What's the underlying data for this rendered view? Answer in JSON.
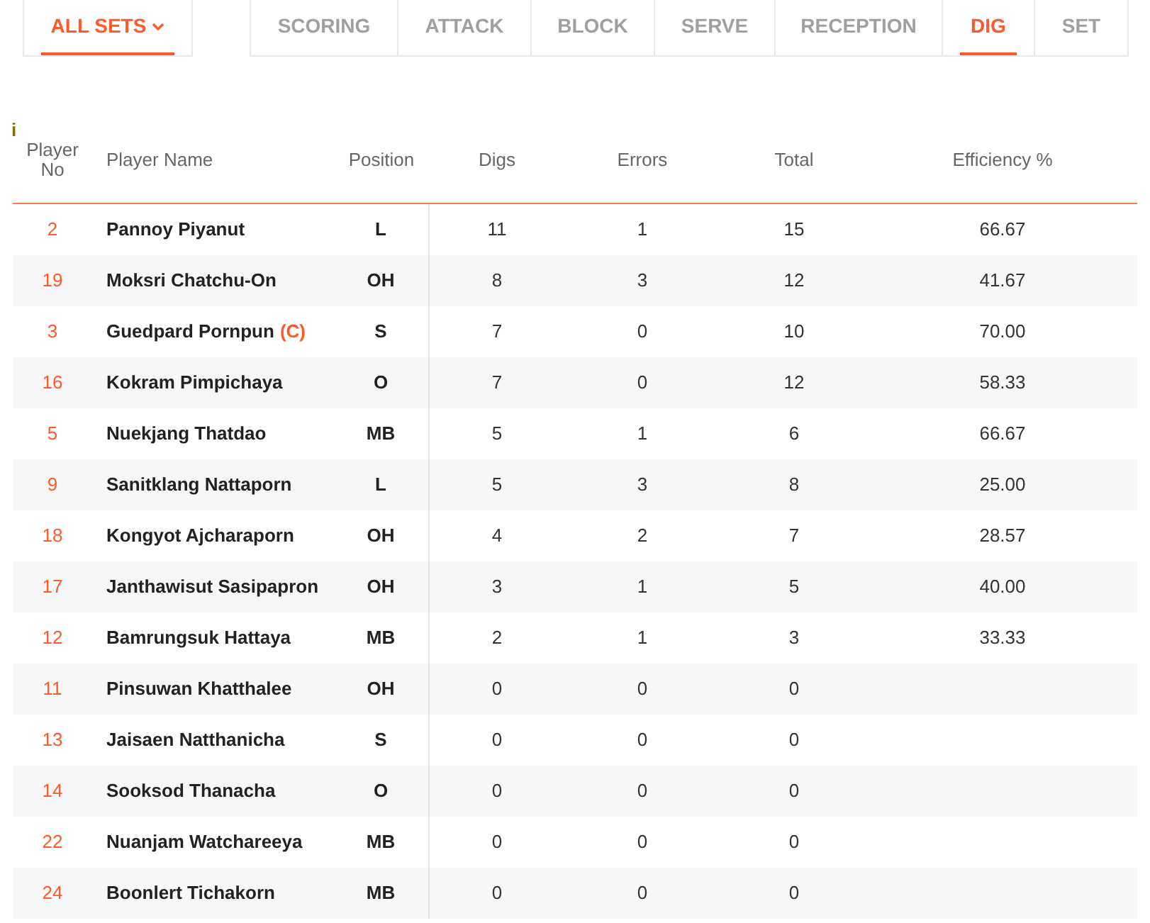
{
  "set_selector": {
    "label": "ALL SETS",
    "expanded": false
  },
  "tabs": [
    {
      "label": "SCORING",
      "selected": false
    },
    {
      "label": "ATTACK",
      "selected": false
    },
    {
      "label": "BLOCK",
      "selected": false
    },
    {
      "label": "SERVE",
      "selected": false
    },
    {
      "label": "RECEPTION",
      "selected": false
    },
    {
      "label": "DIG",
      "selected": true
    },
    {
      "label": "SET",
      "selected": false
    }
  ],
  "info_mark": "i",
  "table": {
    "columns": [
      "Player No",
      "Player Name",
      "Position",
      "Digs",
      "Errors",
      "Total",
      "Efficiency %"
    ],
    "rows": [
      {
        "no": "2",
        "name": "Pannoy Piyanut",
        "position": "L",
        "digs": "11",
        "errors": "1",
        "total": "15",
        "efficiency": "66.67"
      },
      {
        "no": "19",
        "name": "Moksri Chatchu-On",
        "position": "OH",
        "digs": "8",
        "errors": "3",
        "total": "12",
        "efficiency": "41.67"
      },
      {
        "no": "3",
        "name": "Guedpard Pornpun",
        "captain_mark": "(C)",
        "position": "S",
        "digs": "7",
        "errors": "0",
        "total": "10",
        "efficiency": "70.00"
      },
      {
        "no": "16",
        "name": "Kokram Pimpichaya",
        "position": "O",
        "digs": "7",
        "errors": "0",
        "total": "12",
        "efficiency": "58.33"
      },
      {
        "no": "5",
        "name": "Nuekjang Thatdao",
        "position": "MB",
        "digs": "5",
        "errors": "1",
        "total": "6",
        "efficiency": "66.67"
      },
      {
        "no": "9",
        "name": "Sanitklang Nattaporn",
        "position": "L",
        "digs": "5",
        "errors": "3",
        "total": "8",
        "efficiency": "25.00"
      },
      {
        "no": "18",
        "name": "Kongyot Ajcharaporn",
        "position": "OH",
        "digs": "4",
        "errors": "2",
        "total": "7",
        "efficiency": "28.57"
      },
      {
        "no": "17",
        "name": "Janthawisut Sasipapron",
        "position": "OH",
        "digs": "3",
        "errors": "1",
        "total": "5",
        "efficiency": "40.00"
      },
      {
        "no": "12",
        "name": "Bamrungsuk Hattaya",
        "position": "MB",
        "digs": "2",
        "errors": "1",
        "total": "3",
        "efficiency": "33.33"
      },
      {
        "no": "11",
        "name": "Pinsuwan Khatthalee",
        "position": "OH",
        "digs": "0",
        "errors": "0",
        "total": "0"
      },
      {
        "no": "13",
        "name": "Jaisaen Natthanicha",
        "position": "S",
        "digs": "0",
        "errors": "0",
        "total": "0"
      },
      {
        "no": "14",
        "name": "Sooksod Thanacha",
        "position": "O",
        "digs": "0",
        "errors": "0",
        "total": "0"
      },
      {
        "no": "22",
        "name": "Nuanjam Watchareeya",
        "position": "MB",
        "digs": "0",
        "errors": "0",
        "total": "0"
      },
      {
        "no": "24",
        "name": "Boonlert Tichakorn",
        "position": "MB",
        "digs": "0",
        "errors": "0",
        "total": "0"
      }
    ]
  }
}
